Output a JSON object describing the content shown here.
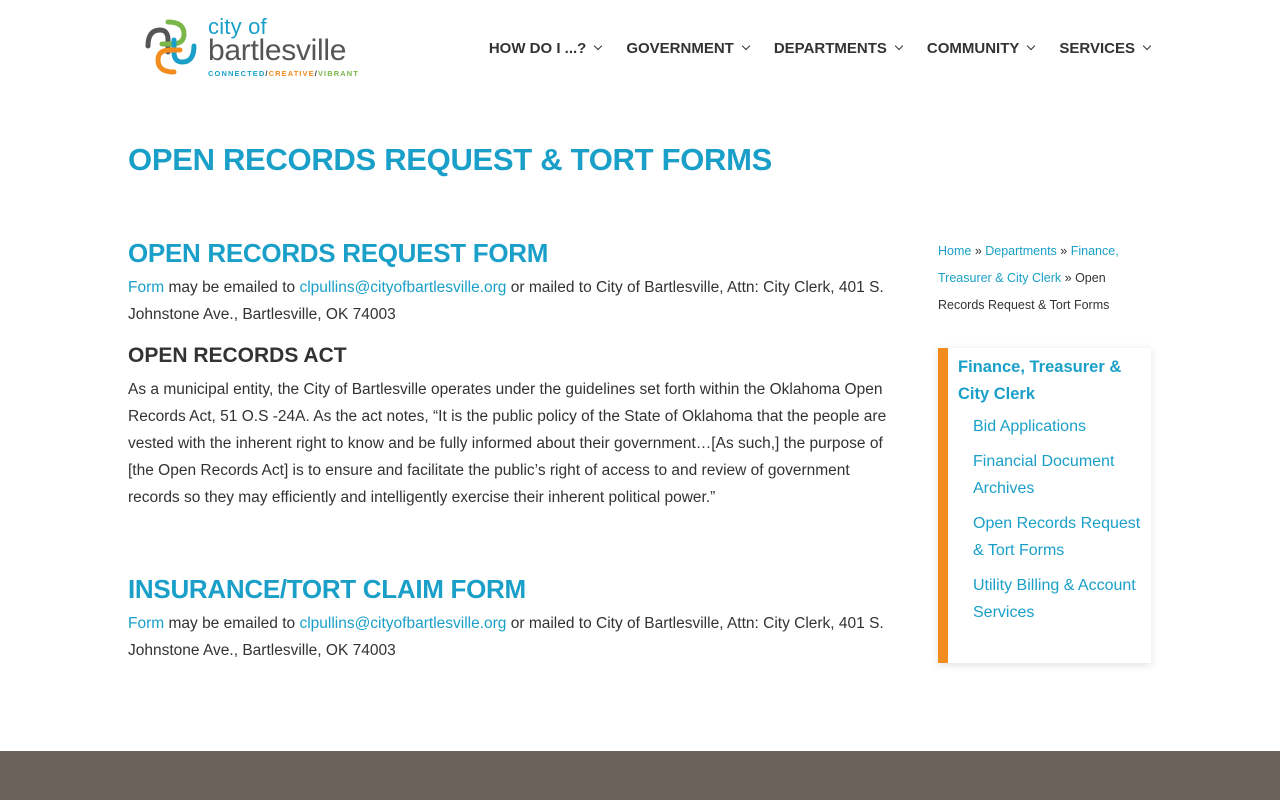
{
  "header": {
    "logo": {
      "city_text": "city of",
      "name_text": "bartlesville",
      "tagline": [
        "CONNECTED",
        "/",
        "CREATIVE",
        "/",
        "VIBRANT"
      ]
    },
    "nav": [
      {
        "label": "HOW DO I ...?"
      },
      {
        "label": "GOVERNMENT"
      },
      {
        "label": "DEPARTMENTS"
      },
      {
        "label": "COMMUNITY"
      },
      {
        "label": "SERVICES"
      }
    ]
  },
  "page": {
    "title": "OPEN RECORDS REQUEST & TORT FORMS"
  },
  "sections": {
    "records_form": {
      "heading": "OPEN RECORDS REQUEST FORM",
      "form_link": "Form",
      "text_a": " may be emailed to ",
      "email": "clpullins@cityofbartlesville.org",
      "text_b": " or mailed to City of Bartlesville, Attn: City Clerk, 401 S. Johnstone Ave., Bartlesville, OK 74003"
    },
    "records_act": {
      "heading": "OPEN RECORDS ACT",
      "body": "As a municipal entity, the City of Bartlesville operates under the guidelines set forth within the Oklahoma Open Records Act, 51 O.S -24A. As the act notes, “It is the public policy of the State of Oklahoma that the people are vested with the inherent right to know and be fully informed about their government…[As such,] the purpose of [the Open Records Act] is to ensure and facilitate the public’s right of access to and review of government records so they may efficiently and intelligently exercise their inherent political power.”"
    },
    "tort_form": {
      "heading": "INSURANCE/TORT CLAIM FORM",
      "form_link": "Form",
      "text_a": " may be emailed to ",
      "email": "clpullins@cityofbartlesville.org",
      "text_b": " or mailed to City of Bartlesville, Attn: City Clerk, 401 S. Johnstone Ave., Bartlesville, OK 74003"
    }
  },
  "breadcrumb": {
    "home": "Home",
    "sep": " » ",
    "departments": "Departments",
    "finance": "Finance, Treasurer & City Clerk",
    "current": "Open Records Request & Tort Forms"
  },
  "subnav": {
    "title": "Finance, Treasurer & City Clerk",
    "items": [
      {
        "label": "Bid Applications"
      },
      {
        "label": "Financial Document Archives"
      },
      {
        "label": "Open Records Request & Tort Forms"
      },
      {
        "label": "Utility Billing & Account Services"
      }
    ]
  },
  "colors": {
    "accent_blue": "#1aa0c8",
    "accent_orange": "#f28c1e",
    "accent_green": "#7ab648",
    "footer": "#6b625b"
  }
}
